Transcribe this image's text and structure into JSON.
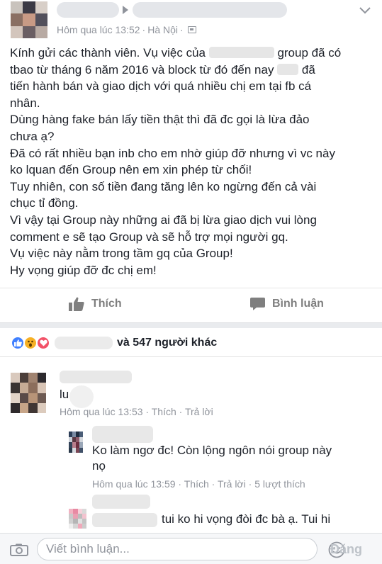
{
  "post": {
    "timestamp": "Hôm qua lúc 13:52",
    "separator": "·",
    "location": "Hà Nội",
    "lines": [
      [
        "Kính gửi các thành viên. Vụ việc của ",
        " group đã có"
      ],
      [
        "tbao từ tháng 6 năm 2016 và block từ đó đến nay ",
        " đã"
      ],
      [
        "tiến hành bán và giao dịch với quá nhiều chị em tại fb cá"
      ],
      [
        "nhân."
      ],
      [
        "Dùng hàng fake bán lấy tiền thật thì đã đc gọi là lừa đảo"
      ],
      [
        "chưa ạ?"
      ],
      [
        "Đã có rất nhiều bạn inb cho em nhờ giúp đỡ nhưng vì vc này"
      ],
      [
        "ko lquan đến Group nên em xin phép từ chối!"
      ],
      [
        "Tuy nhiên, con số tiền đang tăng lên ko ngừng đến cả vài"
      ],
      [
        "chục tỉ đồng."
      ],
      [
        "Vì vậy tại Group này những ai đã bị lừa giao dịch vui lòng"
      ],
      [
        "comment e sẽ tạo Group và sẽ hỗ trợ mọi người gq."
      ],
      [
        "Vụ việc này nằm trong tầm gq của Group!"
      ],
      [
        "Hy vọng giúp đỡ đc chị em!"
      ]
    ]
  },
  "actions": {
    "like_label": "Thích",
    "comment_label": "Bình luận"
  },
  "reactions": {
    "summary": "và 547 người khác"
  },
  "comments": [
    {
      "text": "lu",
      "time": "Hôm qua lúc 13:53",
      "like": "Thích",
      "reply": "Trả lời"
    },
    {
      "text_line1": "Ko làm ngơ đc! Còn lộng ngôn nói group này",
      "text_line2": "nọ",
      "time": "Hôm qua lúc 13:59",
      "like": "Thích",
      "reply": "Trả lời",
      "likes": "5 lượt thích"
    },
    {
      "text_line1": "tui ko hi vọng đòi đc bà ạ. Tui hi"
    }
  ],
  "composer": {
    "placeholder": "Viết bình luận...",
    "post_label": "Đăng"
  },
  "icons": [
    "chevron-down-icon",
    "globe-icon",
    "like-icon",
    "comment-icon",
    "camera-icon",
    "smiley-icon"
  ],
  "colors": {
    "like_reaction": "#4080ff",
    "wow_reaction": "#f7b125",
    "love_reaction": "#f25268",
    "meta_text": "#90949c"
  }
}
